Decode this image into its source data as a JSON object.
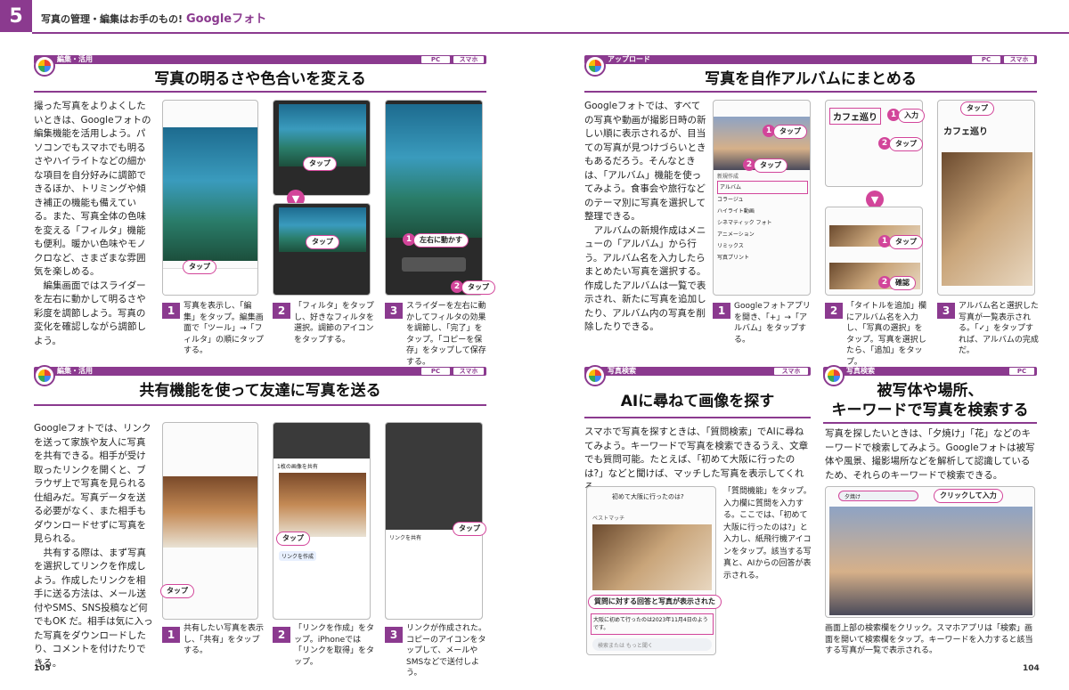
{
  "header": {
    "chapter_number": "5",
    "running_title": "写真の管理・編集はお手のもの!",
    "running_title_brand": "Googleフォト"
  },
  "page_left": {
    "page_number": "105",
    "section1": {
      "tag": "編集・活用",
      "badges": [
        "PC",
        "スマホ"
      ],
      "title": "写真の明るさや色合いを変える",
      "body": "撮った写真をよりよくしたいときは、Googleフォトの編集機能を活用しよう。パソコンでもスマホでも明るさやハイライトなどの細かな項目を自分好みに調節できるほか、トリミングや傾き補正の機能も備えている。また、写真全体の色味を変える「フィルタ」機能も便利。暖かい色味やモノクロなど、さまざまな雰囲気を楽しめる。\n　編集画面ではスライダーを左右に動かして明るさや彩度を調節しよう。写真の変化を確認しながら調節しよう。",
      "callouts": [
        "タップ",
        "タップ",
        "タップ",
        "左右に動かす",
        "タップ"
      ],
      "circle_nums": [
        "1",
        "2"
      ],
      "steps": [
        {
          "num": "1",
          "text": "写真を表示し、「編集」をタップ。編集画面で「ツール」→「フィルタ」の順にタップする。"
        },
        {
          "num": "2",
          "text": "「フィルタ」をタップし、好きなフィルタを選択。調節のアイコンをタップする。"
        },
        {
          "num": "3",
          "text": "スライダーを左右に動かしてフィルタの効果を調節し、「完了」をタップ。「コピーを保存」をタップして保存する。"
        }
      ]
    },
    "section2": {
      "tag": "編集・活用",
      "badges": [
        "PC",
        "スマホ"
      ],
      "title": "共有機能を使って友達に写真を送る",
      "body": "Googleフォトでは、リンクを送って家族や友人に写真を共有できる。相手が受け取ったリンクを開くと、ブラウザ上で写真を見られる仕組みだ。写真データを送る必要がなく、また相手もダウンロードせずに写真を見られる。\n　共有する際は、まず写真を選択してリンクを作成しよう。作成したリンクを相手に送る方法は、メール送付やSMS、SNS投稿など何でもOK だ。相手は気に入った写真をダウンロードしたり、コメントを付けたりできる。",
      "callouts": [
        "タップ",
        "タップ",
        "タップ"
      ],
      "share_header": "1枚の画像を共有",
      "share_link_label": "リンクを作成",
      "share_link_header": "リンクを共有",
      "steps": [
        {
          "num": "1",
          "text": "共有したい写真を表示し、「共有」をタップする。"
        },
        {
          "num": "2",
          "text": "「リンクを作成」をタップ。iPhoneでは「リンクを取得」をタップ。"
        },
        {
          "num": "3",
          "text": "リンクが作成された。コピーのアイコンをタップして、メールやSMSなどで送付しよう。"
        }
      ]
    }
  },
  "page_right": {
    "page_number": "104",
    "section1": {
      "tag": "アップロード",
      "badges": [
        "PC",
        "スマホ"
      ],
      "title": "写真を自作アルバムにまとめる",
      "body": "Googleフォトでは、すべての写真や動画が撮影日時の新しい順に表示されるが、目当ての写真が見つけづらいときもあるだろう。そんなときは、「アルバム」機能を使ってみよう。食事会や旅行などのテーマ別に写真を選択して整理できる。\n　アルバムの新規作成はメニューの「アルバム」から行う。アルバム名を入力したらまとめたい写真を選択する。作成したアルバムは一覧で表示され、新たに写真を追加したり、アルバム内の写真を削除したりできる。",
      "album_name": "カフェ巡り",
      "callouts": [
        "タップ",
        "タップ",
        "入力",
        "タップ",
        "タップ",
        "確認",
        "タップ"
      ],
      "menu_header": "新規作成",
      "menu_items": [
        "アルバム",
        "コラージュ",
        "ハイライト動画",
        "シネマティック フォト",
        "アニメーション",
        "リミックス",
        "写真プリント"
      ],
      "steps": [
        {
          "num": "1",
          "text": "Googleフォトアプリを開き、「+」→「アルバム」をタップする。"
        },
        {
          "num": "2",
          "text": "「タイトルを追加」欄にアルバム名を入力し、「写真の選択」をタップ。写真を選択したら、「追加」をタップ。"
        },
        {
          "num": "3",
          "text": "アルバム名と選択した写真が一覧表示される。「✓」をタップすれば、アルバムの完成だ。"
        }
      ]
    },
    "section2": {
      "tag": "写真検索",
      "badges": [
        "スマホ"
      ],
      "title": "AIに尋ねて画像を探す",
      "body": "スマホで写真を探すときは、「質問検索」でAIに尋ねてみよう。キーワードで写真を検索できるうえ、文章でも質問可能。たとえば、「初めて大阪に行ったのは?」などと聞けば、マッチした写真を表示してくれる。",
      "query": "初めて大阪に行ったのは?",
      "best_match": "ベストマッチ",
      "answer_callout": "質問に対する回答と写真が表示された",
      "answer_text": "大阪に初めて行ったのは2023年11月4日のようです。",
      "ask_placeholder": "検索または もっと聞く",
      "caption": "「質問機能」をタップ。入力欄に質問を入力する。ここでは、「初めて大阪に行ったのは?」と入力し、紙飛行機アイコンをタップ。該当する写真と、AIからの回答が表示される。"
    },
    "section3": {
      "tag": "写真検索",
      "badges": [
        "PC"
      ],
      "title_line1": "被写体や場所、",
      "title_line2": "キーワードで写真を検索する",
      "body": "写真を探したいときは、「夕焼け」「花」などのキーワードで検索してみよう。Googleフォトは被写体や風景、撮影場所などを解析して認識しているため、それらのキーワードで検索できる。",
      "search_word": "夕焼け",
      "callout": "クリックして入力",
      "caption": "画面上部の検索欄をクリック。スマホアプリは「検索」画面を開いて検索欄をタップ。キーワードを入力すると該当する写真が一覧で表示される。"
    }
  }
}
